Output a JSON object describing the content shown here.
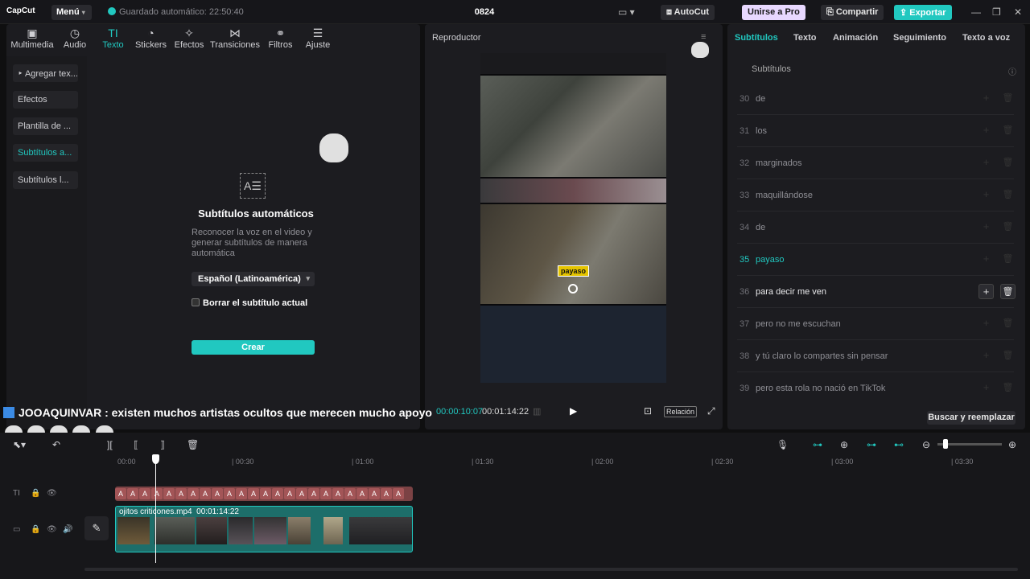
{
  "app": {
    "logo": "CapCut",
    "menu_label": "Menú",
    "autosave": "Guardado automático: 22:50:40",
    "project_title": "0824",
    "autocut_label": "AutoCut",
    "pro_label": "Unirse a Pro",
    "share_label": "Compartir",
    "export_label": "Exportar"
  },
  "left": {
    "tabs": [
      {
        "label": "Multimedia",
        "icon": "media-icon"
      },
      {
        "label": "Audio",
        "icon": "audio-icon"
      },
      {
        "label": "Texto",
        "icon": "text-icon"
      },
      {
        "label": "Stickers",
        "icon": "sticker-icon"
      },
      {
        "label": "Efectos",
        "icon": "effects-icon"
      },
      {
        "label": "Transiciones",
        "icon": "transition-icon"
      },
      {
        "label": "Filtros",
        "icon": "filter-icon"
      },
      {
        "label": "Ajuste",
        "icon": "adjust-icon"
      }
    ],
    "sidebar": [
      {
        "label": "‣ Agregar tex..."
      },
      {
        "label": "Efectos"
      },
      {
        "label": "Plantilla de ..."
      },
      {
        "label": "Subtítulos a..."
      },
      {
        "label": "Subtítulos l..."
      }
    ],
    "auto": {
      "title": "Subtítulos automáticos",
      "description": "Reconocer la voz en el video y generar subtítulos de manera automática",
      "language": "Español (Latinoamérica)",
      "checkbox": "Borrar el subtítulo actual",
      "create": "Crear"
    }
  },
  "player": {
    "title": "Reproductor",
    "subtitle_chip": "payaso",
    "current_time": "00:00:10:07",
    "total_time": "00:01:14:22",
    "ratio_label": "Relación"
  },
  "right": {
    "tabs": [
      "Subtítulos",
      "Texto",
      "Animación",
      "Seguimiento",
      "Texto a voz"
    ],
    "section": "Subtítulos",
    "rows": [
      {
        "num": "30",
        "text": "de"
      },
      {
        "num": "31",
        "text": "los"
      },
      {
        "num": "32",
        "text": "marginados"
      },
      {
        "num": "33",
        "text": "maquillándose"
      },
      {
        "num": "34",
        "text": "de"
      },
      {
        "num": "35",
        "text": "payaso"
      },
      {
        "num": "36",
        "text": "para decir me ven"
      },
      {
        "num": "37",
        "text": "pero no me escuchan"
      },
      {
        "num": "38",
        "text": "y tú claro lo compartes sin pensar"
      },
      {
        "num": "39",
        "text": "pero esta rola no nació en TikTok"
      }
    ],
    "find_replace": "Buscar y reemplazar"
  },
  "overlay": {
    "comment_user": "JOOAQUINVAR",
    "comment_text": ": existen muchos artistas ocultos que merecen mucho apoyo"
  },
  "timeline": {
    "ruler": [
      "00:00",
      "| 00:30",
      "| 01:00",
      "| 01:30",
      "| 02:00",
      "| 02:30",
      "| 03:00",
      "| 03:30"
    ],
    "video_clip_name": "ojitos criticones.mp4",
    "video_clip_duration": "00:01:14:22",
    "text_clip_glyph": "A"
  },
  "colors": {
    "accent": "#21c8c0",
    "text_clip": "#7b4244",
    "video_clip": "#1d6e6a",
    "subtitle_chip": "#e5c400"
  }
}
